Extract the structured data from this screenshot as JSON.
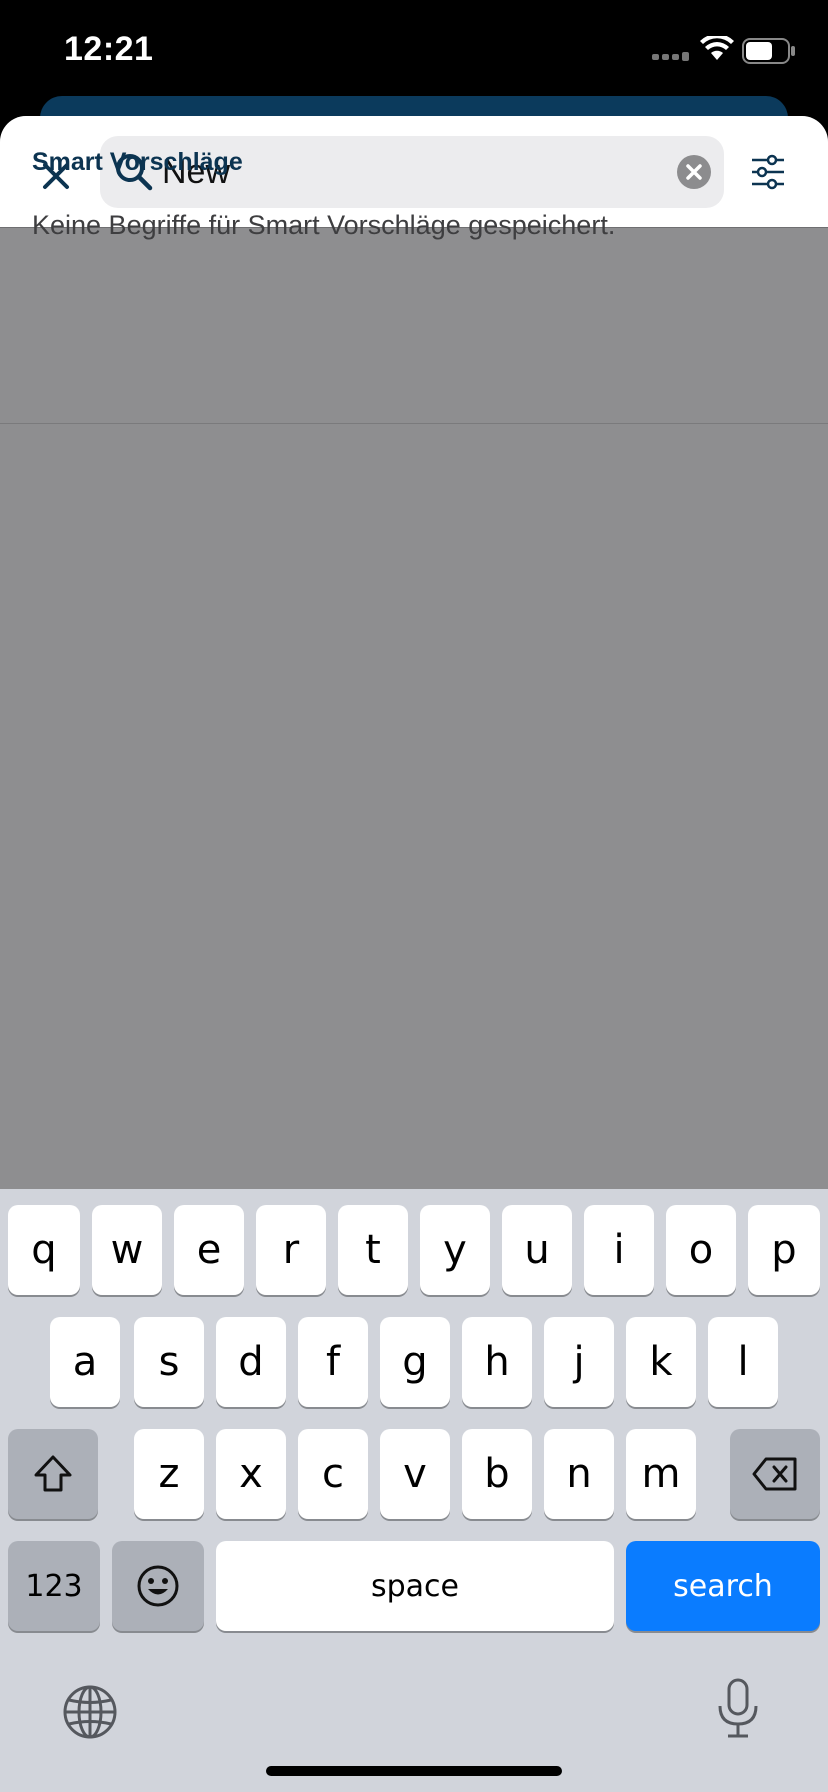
{
  "status_bar": {
    "time": "12:21"
  },
  "search": {
    "value": "New"
  },
  "suggestions": {
    "title": "Smart Vorschläge",
    "empty_text": "Keine Begriffe für Smart Vorschläge gespeichert."
  },
  "keyboard": {
    "row1": [
      "q",
      "w",
      "e",
      "r",
      "t",
      "y",
      "u",
      "i",
      "o",
      "p"
    ],
    "row2": [
      "a",
      "s",
      "d",
      "f",
      "g",
      "h",
      "j",
      "k",
      "l"
    ],
    "row3": [
      "z",
      "x",
      "c",
      "v",
      "b",
      "n",
      "m"
    ],
    "numbers_label": "123",
    "space_label": "space",
    "search_label": "search"
  },
  "colors": {
    "accent": "#0c3451",
    "keyboard_action": "#0a7cff"
  }
}
